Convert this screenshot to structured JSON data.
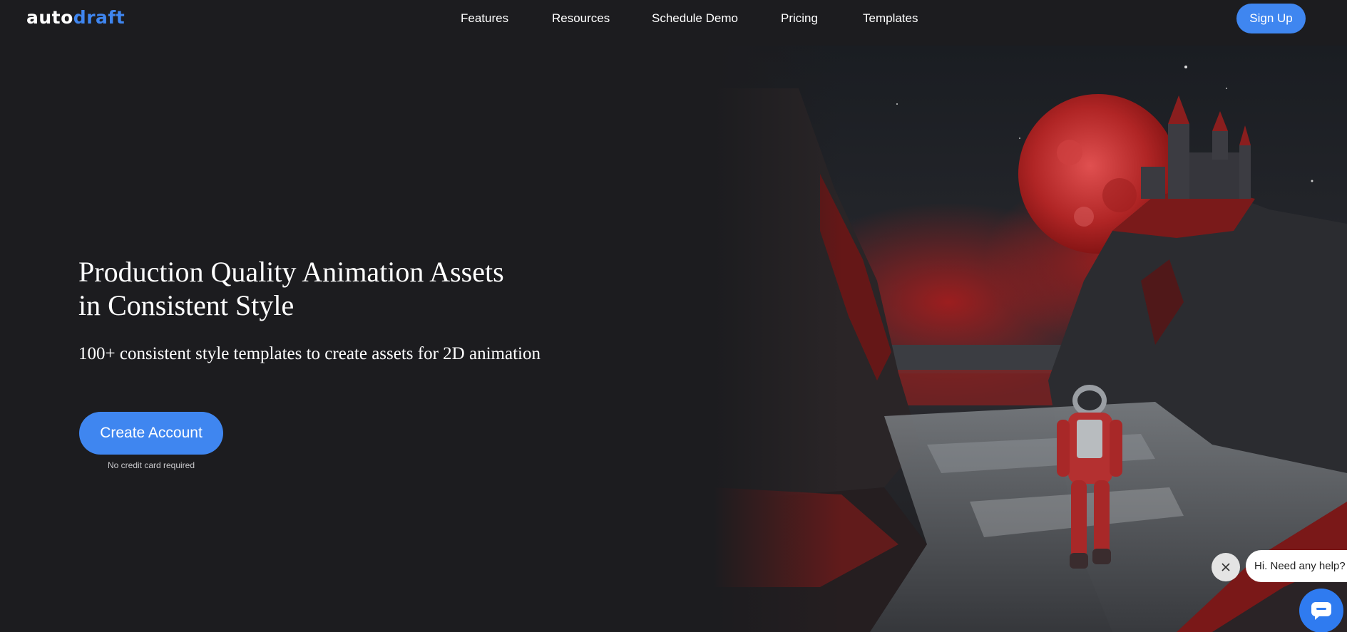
{
  "logo": {
    "part1": "auto",
    "part2": "draft"
  },
  "nav": {
    "links": [
      "Features",
      "Resources",
      "Schedule Demo",
      "Pricing",
      "Templates"
    ],
    "signup_label": "Sign Up"
  },
  "hero": {
    "title_line1": "Production Quality Animation Assets",
    "title_line2": "in Consistent Style",
    "subtitle": "100+ consistent style templates to create assets for 2D animation",
    "cta_label": "Create Account",
    "cta_note": "No credit card required"
  },
  "chat": {
    "greeting": "Hi. Need any help?",
    "close_icon": "close-icon",
    "launcher_icon": "chat-icon"
  },
  "colors": {
    "background": "#1c1c1f",
    "accent": "#3f86f0",
    "text": "#ffffff"
  }
}
